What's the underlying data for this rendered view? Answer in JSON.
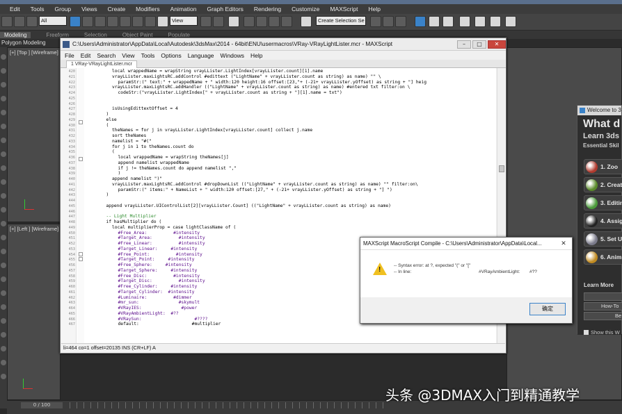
{
  "app": {
    "menu": [
      "Edit",
      "Tools",
      "Group",
      "Views",
      "Create",
      "Modifiers",
      "Animation",
      "Graph Editors",
      "Rendering",
      "Customize",
      "MAXScript",
      "Help"
    ],
    "toolbar": {
      "filter_value": "All",
      "view_value": "View",
      "selection_set_value": "Create Selection Se"
    },
    "ribbon_tabs": [
      "Modeling",
      "Freeform",
      "Selection",
      "Object Paint",
      "Populate"
    ],
    "ribbon_sub": "Polygon Modeling",
    "viewports": {
      "top_label": "[+] [Top ] [Wireframe]",
      "left_label": "[+] [Left ] [Wireframe]"
    },
    "timeline": {
      "frame_label": "0 / 100"
    }
  },
  "welcome": {
    "title": "Welcome to 3",
    "heading": "What d",
    "subheading": "Learn 3ds",
    "essential": "Essential Skil",
    "items": [
      {
        "label": "1. Zoo",
        "color": "#b03a2e"
      },
      {
        "label": "2. Creat",
        "color": "#5a8a2a"
      },
      {
        "label": "3. Editin",
        "color": "#4a9a3a"
      },
      {
        "label": "4. Assig",
        "color": "#222222"
      },
      {
        "label": "5. Set U",
        "color": "#7a7a8a"
      },
      {
        "label": "6. Anim",
        "color": "#c08a20"
      }
    ],
    "learn_more": "Learn More",
    "how_to": "How-To",
    "more_btn": "Be",
    "show_label": "Show this W"
  },
  "editor": {
    "title": "C:\\Users\\Administrator\\AppData\\Local\\Autodesk\\3dsMax\\2014 - 64bit\\ENU\\usermacros\\VRay-VRayLightLister.mcr - MAXScript",
    "menu": [
      "File",
      "Edit",
      "Search",
      "View",
      "Tools",
      "Options",
      "Language",
      "Windows",
      "Help"
    ],
    "tab": "1 VRay-VRayLightLister.mcr",
    "status": "li=464 co=1 offset=20135 INS (CR+LF) A",
    "lines": [
      {
        "n": "420",
        "indent": 2,
        "text": "local wrappedName = wrapString vrayLLister.LightIndex[vrayLLister.count][1].name"
      },
      {
        "n": "421",
        "indent": 2,
        "text": "vrayLLister.maxLightsRC.addControl #edittext (\"LightName\" + vrayLLister.count as string) as name) \"\" \\"
      },
      {
        "n": "422",
        "indent": 3,
        "text": "paramStr:(\" text:\" + wrappedName + \" width:120 height:16 offset:[23,\"+ (-21+ vrayLLister.yOffset) as string + \"] heig"
      },
      {
        "n": "423",
        "indent": 2,
        "text": "vrayLLister.maxLightsRC.addHandler ((\"LightName\" + vrayLLister.count as string) as name) #entered txt filter:on \\"
      },
      {
        "n": "424",
        "indent": 3,
        "text": "codeStr:(\"vrayLLister.LightIndex[\" + vrayLLister.count as string + \"][1].name = txt\")"
      },
      {
        "n": "425",
        "indent": 0,
        "text": ""
      },
      {
        "n": "426",
        "indent": 0,
        "text": ""
      },
      {
        "n": "427",
        "indent": 2,
        "text": "isUsingEdittextOffset = 4"
      },
      {
        "n": "428",
        "indent": 1,
        "text": ")"
      },
      {
        "n": "429",
        "indent": 1,
        "text": "else"
      },
      {
        "n": "430",
        "indent": 1,
        "text": "("
      },
      {
        "n": "431",
        "indent": 2,
        "text": "theNames = for j in vrayLLister.LightIndex[vrayLLister.count] collect j.name"
      },
      {
        "n": "432",
        "indent": 2,
        "text": "sort theNames"
      },
      {
        "n": "433",
        "indent": 2,
        "text": "namelist = \"#(\""
      },
      {
        "n": "434",
        "indent": 2,
        "text": "for j in 1 to theNames.count do"
      },
      {
        "n": "435",
        "indent": 2,
        "text": "("
      },
      {
        "n": "436",
        "indent": 3,
        "text": "local wrappedName = wrapString theNames[j]"
      },
      {
        "n": "437",
        "indent": 3,
        "text": "append namelist wrappedName"
      },
      {
        "n": "438",
        "indent": 3,
        "text": "if j != theNames.count do append namelist \",\""
      },
      {
        "n": "439",
        "indent": 3,
        "text": ")"
      },
      {
        "n": "440",
        "indent": 2,
        "text": "append namelist \")\""
      },
      {
        "n": "441",
        "indent": 2,
        "text": "vrayLLister.maxLightsRC.addControl #dropDownList ((\"LightName\" + vrayLLister.count as string) as name) \"\" filter:on\\"
      },
      {
        "n": "442",
        "indent": 3,
        "text": "paramStr:(\" items:\" + NameList + \" width:120 offset:[27,\" + (-21+ vrayLLister.yOffset) as string + \"] \")"
      },
      {
        "n": "443",
        "indent": 1,
        "text": ")"
      },
      {
        "n": "444",
        "indent": 0,
        "text": ""
      },
      {
        "n": "445",
        "indent": 1,
        "text": "append vrayLLister.UIControlList[2][vrayLLister.Count] ((\"LightName\" + vrayLLister.count as string) as name)"
      },
      {
        "n": "446",
        "indent": 0,
        "text": ""
      },
      {
        "n": "447",
        "indent": 1,
        "text": "-- Light Multiplier"
      },
      {
        "n": "448",
        "indent": 1,
        "text": "if hasMultiplier do ("
      },
      {
        "n": "449",
        "indent": 2,
        "text": "local multiplierProp = case lightClassName of ("
      },
      {
        "n": "450",
        "indent": 3,
        "text": "#Free_Area:          #intensity"
      },
      {
        "n": "451",
        "indent": 3,
        "text": "#Target_Area:          #intensity"
      },
      {
        "n": "452",
        "indent": 3,
        "text": "#Free_Linear:          #intensity"
      },
      {
        "n": "453",
        "indent": 3,
        "text": "#Target_Linear:     #intensity"
      },
      {
        "n": "454",
        "indent": 3,
        "text": "#Free_Point:          #intensity"
      },
      {
        "n": "455",
        "indent": 3,
        "text": "#Target_Point:     #intensity"
      },
      {
        "n": "456",
        "indent": 3,
        "text": "#Free_Sphere:     #intensity"
      },
      {
        "n": "457",
        "indent": 3,
        "text": "#Target_Sphere:     #intensity"
      },
      {
        "n": "458",
        "indent": 3,
        "text": "#Free_Disc:          #intensity"
      },
      {
        "n": "459",
        "indent": 3,
        "text": "#Target_Disc:          #intensity"
      },
      {
        "n": "460",
        "indent": 3,
        "text": "#Free_Cylinder:     #intensity"
      },
      {
        "n": "461",
        "indent": 3,
        "text": "#Target_Cylinder:  #intensity"
      },
      {
        "n": "462",
        "indent": 3,
        "text": "#Luminaire:          #dimmer"
      },
      {
        "n": "463",
        "indent": 3,
        "text": "#mr_sun:               #skymult"
      },
      {
        "n": "464",
        "indent": 3,
        "text": "#VRayIES:               #power"
      },
      {
        "n": "465",
        "indent": 3,
        "text": "#VRayAmbientLight:  #??"
      },
      {
        "n": "466",
        "indent": 3,
        "text": "#VRaySun:                    #????"
      },
      {
        "n": "467",
        "indent": 3,
        "text": "default:                    #multiplier"
      }
    ]
  },
  "dialog": {
    "title": "MAXScript MacroScript Compile - C:\\Users\\Administrator\\AppData\\Local...",
    "message1": "-- Syntax error: at ?, expected \"(\" or \"[\"",
    "message2": "--  In line:",
    "line_value": "#VRayAmbientLight:",
    "line_value2": "#??",
    "ok": "确定"
  },
  "watermark": "头条 @3DMAX入门到精通教学"
}
